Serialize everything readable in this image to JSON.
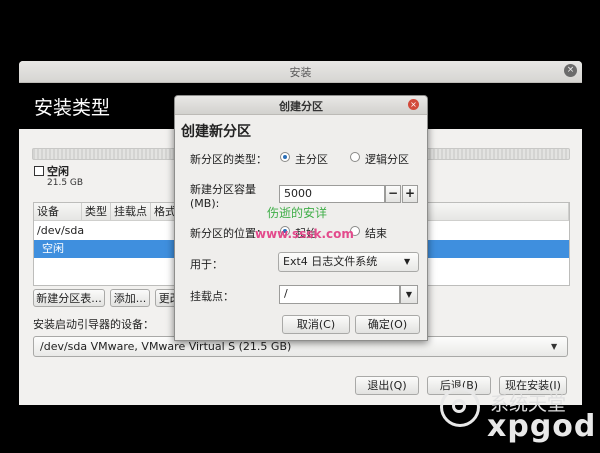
{
  "window": {
    "title": "安装",
    "close_glyph": "×"
  },
  "page_title": "安装类型",
  "free_space": {
    "label": "空闲",
    "size": "21.5 GB"
  },
  "table": {
    "columns": [
      "设备",
      "类型",
      "挂载点",
      "格式"
    ],
    "rows": [
      {
        "label": "/dev/sda"
      },
      {
        "label": "空闲"
      }
    ]
  },
  "actions": {
    "new_partition_table": "新建分区表...",
    "add": "添加...",
    "change": "更改..."
  },
  "bootloader": {
    "label": "安装启动引导器的设备：",
    "value": "/dev/sda   VMware, VMware Virtual S (21.5 GB)"
  },
  "footer": {
    "quit": "退出(Q)",
    "back": "后退(B)",
    "install_now": "现在安装(I)"
  },
  "dialog": {
    "title": "创建分区",
    "heading": "创建新分区",
    "type_label": "新分区的类型：",
    "type_primary": "主分区",
    "type_logical": "逻辑分区",
    "size_label_line1": "新建分区容量",
    "size_label_line2": "(MB):",
    "size_value": "5000",
    "minus": "−",
    "plus": "+",
    "location_label": "新分区的位置：",
    "location_begin": "起始",
    "location_end": "结束",
    "use_label": "用于：",
    "use_value": "Ext4 日志文件系统",
    "mount_label": "挂载点：",
    "mount_value": "/",
    "cancel": "取消(C)",
    "ok": "确定(O)"
  },
  "watermark": {
    "line1": "伤逝的安详",
    "line2": "www.sssk.com"
  },
  "logo": {
    "line1": "系统天堂",
    "line2": "xpgod"
  },
  "icons": {
    "combo_arrow": "▼"
  }
}
